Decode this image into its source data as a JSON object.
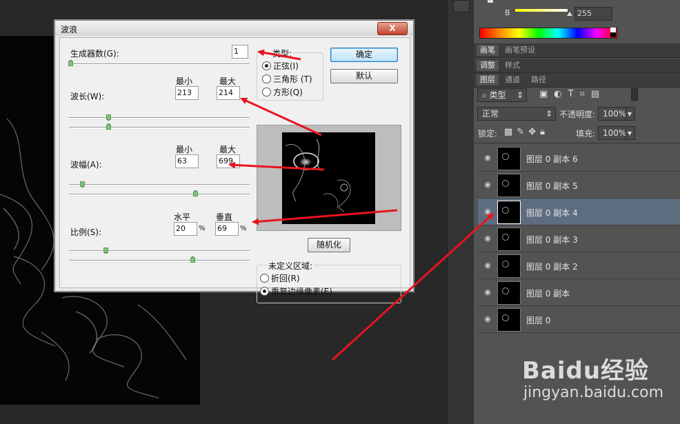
{
  "dialog": {
    "title": "波浪",
    "close_label": "X",
    "generators_label": "生成器数(G):",
    "generators_value": "1",
    "wavelength_label": "波长(W):",
    "amplitude_label": "波幅(A):",
    "scale_label": "比例(S):",
    "min_label": "最小",
    "max_label": "最大",
    "wavelength_min": "213",
    "wavelength_max": "214",
    "amplitude_min": "63",
    "amplitude_max": "699",
    "horizontal_label": "水平",
    "vertical_label": "垂直",
    "scale_h": "20",
    "scale_v": "69",
    "percent": "%",
    "type_group_label": "类型:",
    "type_options": [
      "正弦(I)",
      "三角形 (T)",
      "方形(Q)"
    ],
    "ok_label": "确定",
    "default_label": "默认",
    "randomize_label": "随机化",
    "undefined_group_label": "未定义区域:",
    "undefined_options": [
      "折回(R)",
      "重复边缘像素(E)"
    ]
  },
  "panel": {
    "channel_b_label": "B",
    "channel_b_value": "255",
    "tabs_row1": [
      "画笔",
      "画笔预设"
    ],
    "tabs_row2": [
      "调整",
      "样式"
    ],
    "tabs_row3": [
      "图层",
      "通道",
      "路径"
    ],
    "kind_label": "类型",
    "blend_mode": "正常",
    "opacity_label": "不透明度:",
    "opacity_value": "100%",
    "lock_label": "锁定:",
    "fill_label": "填充:",
    "fill_value": "100%",
    "layers": [
      "图层 0 副本 6",
      "图层 0 副本 5",
      "图层 0 副本 4",
      "图层 0 副本 3",
      "图层 0 副本 2",
      "图层 0 副本",
      "图层 0"
    ]
  },
  "watermark": {
    "brand": "Baidu经验",
    "url": "jingyan.baidu.com"
  },
  "colors": {
    "accent_arrow": "#e8141e",
    "selected_layer": "#5e6c80"
  }
}
